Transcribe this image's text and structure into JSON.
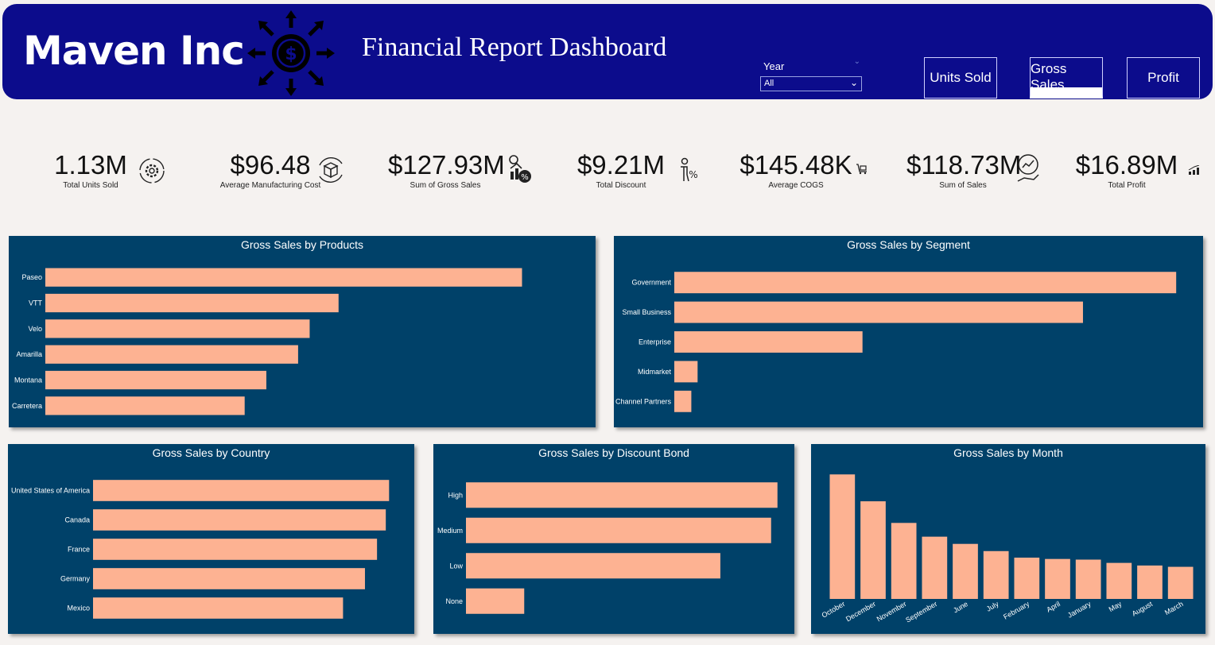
{
  "header": {
    "brand": "Maven Inc",
    "title": "Financial Report Dashboard",
    "slicer": {
      "label": "Year",
      "value": "All"
    },
    "nav": [
      {
        "label": "Units Sold",
        "active": false
      },
      {
        "label": "Gross Sales",
        "active": true
      },
      {
        "label": "Profit",
        "active": false
      }
    ],
    "colors": {
      "header_bg": "#0c0c8c",
      "panel_bg": "#004169",
      "bar": "#fdb292"
    }
  },
  "kpis": [
    {
      "value": "1.13M",
      "label": "Total Units Sold",
      "icon": "gear-cycle-icon"
    },
    {
      "value": "$96.48",
      "label": "Average Manufacturing Cost",
      "icon": "box-cycle-icon"
    },
    {
      "value": "$127.93M",
      "label": "Sum of Gross Sales",
      "icon": "sales-percent-icon"
    },
    {
      "value": "$9.21M",
      "label": "Total Discount",
      "icon": "discount-person-icon"
    },
    {
      "value": "$145.48K",
      "label": "Average COGS",
      "icon": "cart-icon"
    },
    {
      "value": "$118.73M",
      "label": "Sum of Sales",
      "icon": "hand-chart-icon"
    },
    {
      "value": "$16.89M",
      "label": "Total Profit",
      "icon": "bar-growth-icon"
    }
  ],
  "chart_data": [
    {
      "type": "bar",
      "orientation": "horizontal",
      "title": "Gross Sales by Products",
      "categories": [
        "Paseo",
        "VTT",
        "Velo",
        "Amarilla",
        "Montana",
        "Carretera"
      ],
      "values": [
        33.0,
        20.3,
        18.3,
        17.5,
        15.3,
        13.8
      ],
      "xlim": [
        0,
        36
      ]
    },
    {
      "type": "bar",
      "orientation": "horizontal",
      "title": "Gross Sales by Segment",
      "categories": [
        "Government",
        "Small Business",
        "Enterprise",
        "Midmarket",
        "Channel Partners"
      ],
      "values": [
        56.0,
        45.6,
        21.0,
        2.6,
        1.9
      ],
      "xlim": [
        0,
        59
      ]
    },
    {
      "type": "bar",
      "orientation": "horizontal",
      "title": "Gross Sales by Country",
      "categories": [
        "United States of America",
        "Canada",
        "France",
        "Germany",
        "Mexico"
      ],
      "values": [
        27.0,
        26.7,
        25.9,
        24.8,
        22.8
      ],
      "xlim": [
        0,
        28.5
      ]
    },
    {
      "type": "bar",
      "orientation": "horizontal",
      "title": "Gross Sales by Discount Bond",
      "categories": [
        "High",
        "Medium",
        "Low",
        "None"
      ],
      "values": [
        54.0,
        52.9,
        44.1,
        10.1
      ],
      "xlim": [
        0,
        55
      ]
    },
    {
      "type": "bar",
      "orientation": "vertical",
      "title": "Gross Sales by Month",
      "categories": [
        "October",
        "December",
        "November",
        "September",
        "June",
        "July",
        "February",
        "April",
        "January",
        "May",
        "August",
        "March"
      ],
      "values": [
        19.0,
        14.9,
        11.6,
        9.5,
        8.4,
        7.3,
        6.3,
        6.1,
        6.0,
        5.5,
        5.1,
        4.9
      ],
      "ylim": [
        0,
        20
      ]
    }
  ]
}
